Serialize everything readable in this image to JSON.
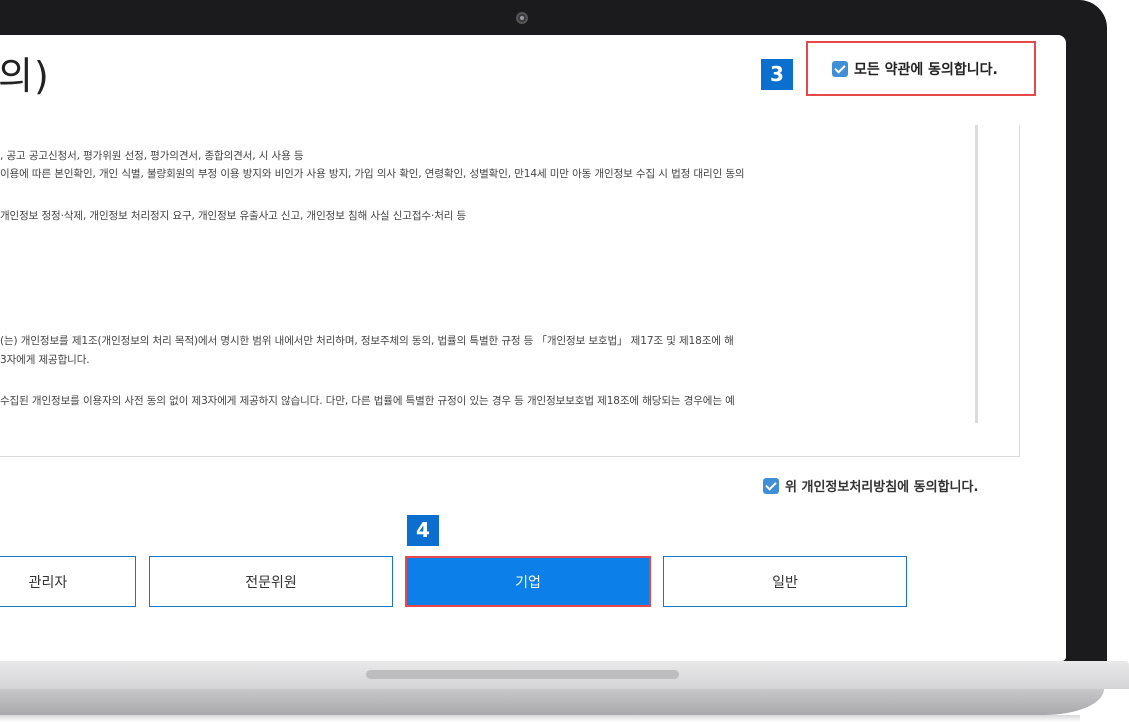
{
  "header": {
    "title": "의)",
    "badge_step3": "3",
    "agree_all_label": "모든 약관에 동의합니다."
  },
  "policy": {
    "lines": [
      ", 공고 공고신청서, 평가위원 선정, 평가의견서, 종합의견서, 시 사용 등",
      "이용에 따른 본인확인, 개인 식별, 불량회원의 부정 이용 방지와 비인가 사용 방지, 가입 의사 확인, 연령확인, 성별확인, 만14세 미만 아동 개인정보 수집 시 법정 대리인 동의",
      "개인정보 정정·삭제, 개인정보 처리정지 요구, 개인정보 유출사고 신고, 개인정보 침해 사실 신고접수·처리 등",
      "(는) 개인정보를 제1조(개인정보의 처리 목적)에서 명시한 범위 내에서만 처리하며, 정보주체의 동의, 법률의 특별한 규정 등 「개인정보 보호법」 제17조 및 제18조에 해",
      "3자에게 제공합니다.",
      "수집된 개인정보를 이용자의 사전 동의 없이 제3자에게 제공하지 않습니다. 다만, 다른 법률에 특별한 규정이 있는 경우 등 개인정보보호법 제18조에 해당되는 경우에는 예"
    ],
    "agree_label": "위 개인정보처리방침에 동의합니다."
  },
  "member_types": {
    "badge_step4": "4",
    "admin": "관리자",
    "expert": "전문위원",
    "corporate": "기업",
    "general": "일반",
    "selected": "기업"
  },
  "colors": {
    "accent": "#0d7fe8",
    "badge": "#0b6fd0",
    "highlight_border": "#e8474c",
    "checkbox": "#3f8fd8"
  }
}
